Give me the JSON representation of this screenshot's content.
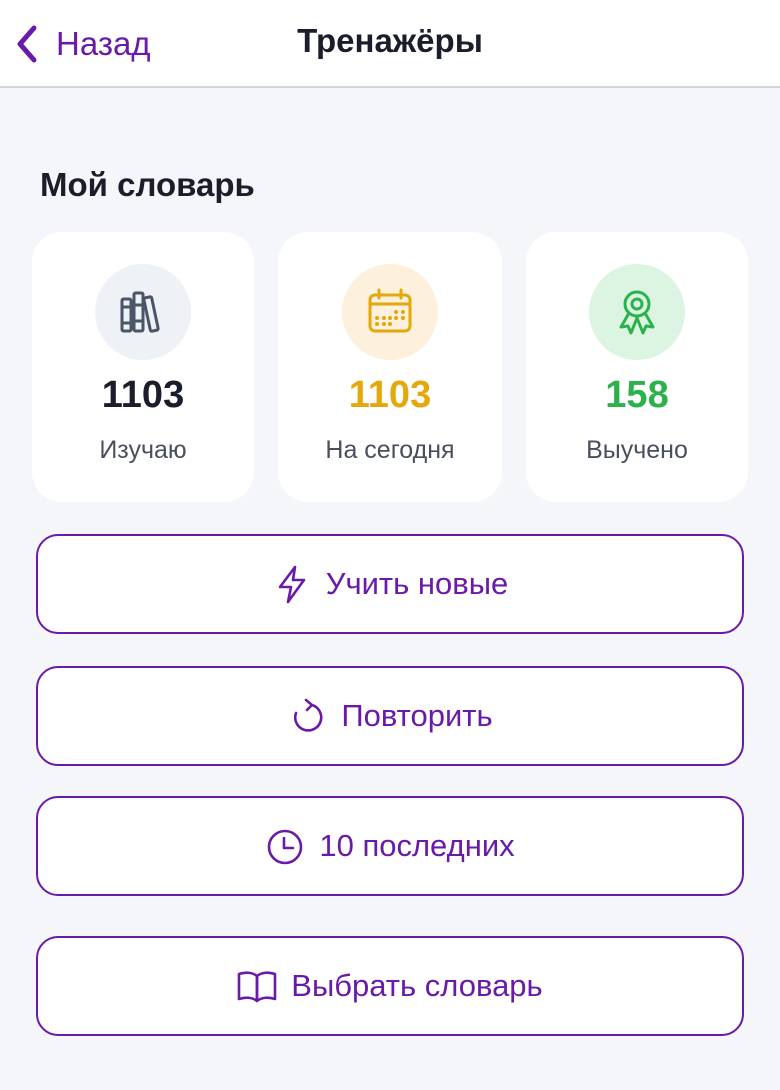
{
  "header": {
    "back_label": "Назад",
    "title": "Тренажёры"
  },
  "section": {
    "title": "Мой словарь"
  },
  "stats": [
    {
      "icon": "books-icon",
      "value": "1103",
      "label": "Изучаю",
      "color": "#1b1d2b",
      "bg": "#eef1f6",
      "icon_color": "#4a5568"
    },
    {
      "icon": "calendar-icon",
      "value": "1103",
      "label": "На сегодня",
      "color": "#e3a80b",
      "bg": "#fdf0dc",
      "icon_color": "#e3a80b"
    },
    {
      "icon": "award-icon",
      "value": "158",
      "label": "Выучено",
      "color": "#2bb24c",
      "bg": "#dcf5e3",
      "icon_color": "#2bb24c"
    }
  ],
  "actions": [
    {
      "icon": "lightning-icon",
      "label": "Учить новые"
    },
    {
      "icon": "refresh-icon",
      "label": "Повторить"
    },
    {
      "icon": "clock-icon",
      "label": "10 последних"
    },
    {
      "icon": "book-open-icon",
      "label": "Выбрать словарь"
    }
  ],
  "colors": {
    "accent": "#6a1aa8",
    "background": "#f5f6fa"
  }
}
